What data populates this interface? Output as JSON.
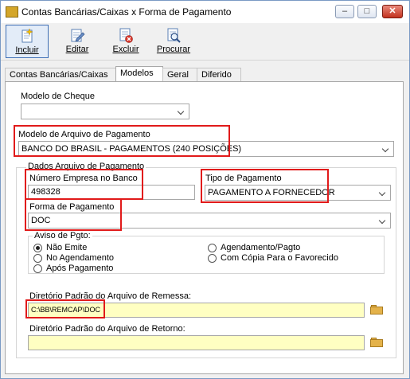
{
  "window": {
    "title": "Contas Bancárias/Caixas x Forma de Pagamento",
    "minimize": "–",
    "maximize": "□",
    "close": "✕"
  },
  "toolbar": {
    "incluir": "Incluir",
    "editar": "Editar",
    "excluir": "Excluir",
    "procurar": "Procurar"
  },
  "tabs": [
    "Contas Bancárias/Caixas",
    "Modelos",
    "Geral",
    "Diferido"
  ],
  "selected_tab": "Modelos",
  "form": {
    "modelo_cheque_label": "Modelo de Cheque",
    "modelo_cheque_value": "",
    "modelo_arquivo_label": "Modelo de Arquivo de Pagamento",
    "modelo_arquivo_value": "BANCO DO BRASIL - PAGAMENTOS (240 POSIÇÕES)",
    "dados_group_label": "Dados Arquivo de Pagamento",
    "numero_empresa_label": "Número Empresa no Banco",
    "numero_empresa_value": "498328",
    "tipo_pagamento_label": "Tipo de Pagamento",
    "tipo_pagamento_value": "PAGAMENTO A FORNECEDOR",
    "forma_pagamento_label": "Forma de Pagamento",
    "forma_pagamento_value": "DOC",
    "aviso_label": "Aviso de Pgto:",
    "aviso_options": [
      "Não Emite",
      "No Agendamento",
      "Após Pagamento",
      "Agendamento/Pagto",
      "Com Cópia Para o Favorecido"
    ],
    "aviso_selected": "Não Emite",
    "dir_remessa_label": "Diretório Padrão do Arquivo de Remessa:",
    "dir_remessa_value": "C:\\BB\\REMCAP\\DOC",
    "dir_retorno_label": "Diretório Padrão do Arquivo de Retorno:",
    "dir_retorno_value": ""
  },
  "colors": {
    "highlight": "#e11a1a",
    "field_yellow": "#ffffc2",
    "close_button": "#c2321f"
  }
}
